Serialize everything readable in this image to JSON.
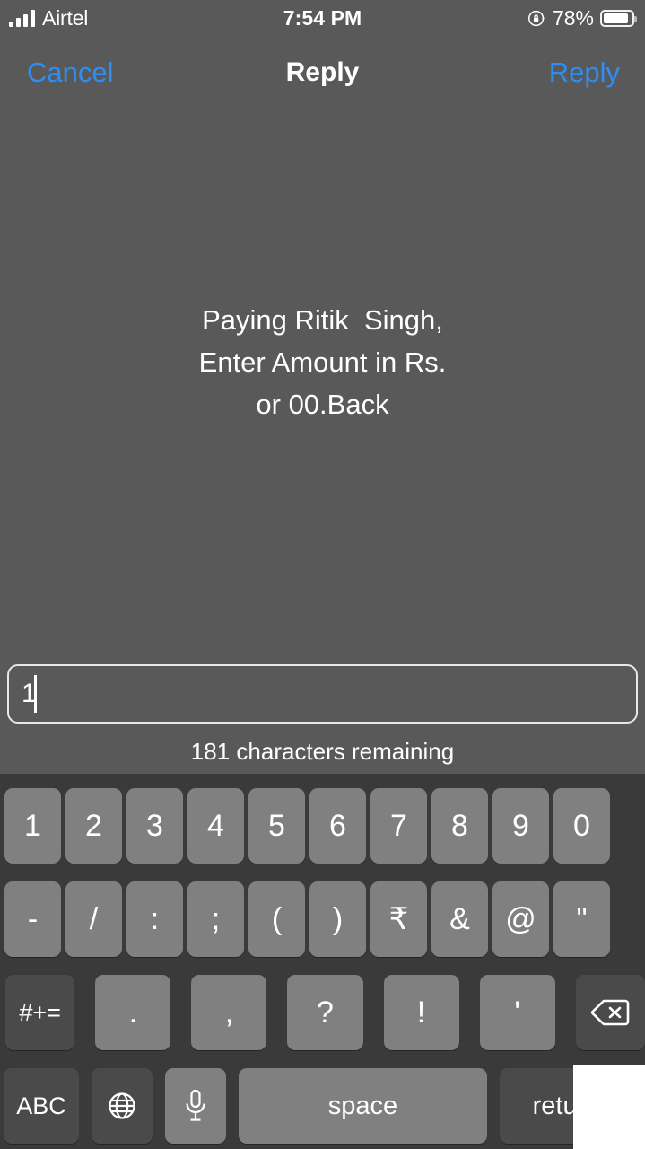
{
  "status_bar": {
    "carrier": "Airtel",
    "signal_icon": "signal-bars-icon",
    "time": "7:54 PM",
    "rotation_lock_icon": "rotation-lock-icon",
    "battery_percent": "78%",
    "battery_icon": "battery-icon"
  },
  "nav_bar": {
    "cancel_label": "Cancel",
    "title": "Reply",
    "action_label": "Reply",
    "accent_color": "#2f8ef0"
  },
  "main": {
    "message": "Paying Ritik  Singh,\nEnter Amount in Rs.\nor 00.Back"
  },
  "input": {
    "value": "1",
    "placeholder": "",
    "char_count": "181 characters remaining"
  },
  "keyboard": {
    "row1": [
      {
        "label": "1",
        "name": "key-1",
        "style": "light"
      },
      {
        "label": "2",
        "name": "key-2",
        "style": "light"
      },
      {
        "label": "3",
        "name": "key-3",
        "style": "light"
      },
      {
        "label": "4",
        "name": "key-4",
        "style": "light"
      },
      {
        "label": "5",
        "name": "key-5",
        "style": "light"
      },
      {
        "label": "6",
        "name": "key-6",
        "style": "light"
      },
      {
        "label": "7",
        "name": "key-7",
        "style": "light"
      },
      {
        "label": "8",
        "name": "key-8",
        "style": "light"
      },
      {
        "label": "9",
        "name": "key-9",
        "style": "light"
      },
      {
        "label": "0",
        "name": "key-0",
        "style": "light"
      }
    ],
    "row2": [
      {
        "label": "-",
        "name": "key-hyphen",
        "style": "light"
      },
      {
        "label": "/",
        "name": "key-slash",
        "style": "light"
      },
      {
        "label": ":",
        "name": "key-colon",
        "style": "light"
      },
      {
        "label": ";",
        "name": "key-semicolon",
        "style": "light"
      },
      {
        "label": "(",
        "name": "key-left-paren",
        "style": "light"
      },
      {
        "label": ")",
        "name": "key-right-paren",
        "style": "light"
      },
      {
        "label": "₹",
        "name": "key-rupee",
        "style": "light"
      },
      {
        "label": "&",
        "name": "key-ampersand",
        "style": "light"
      },
      {
        "label": "@",
        "name": "key-at",
        "style": "light"
      },
      {
        "label": "\"",
        "name": "key-quote",
        "style": "light"
      }
    ],
    "row3": {
      "symbols_label": "#+=",
      "keys": [
        {
          "label": ".",
          "name": "key-period"
        },
        {
          "label": ",",
          "name": "key-comma"
        },
        {
          "label": "?",
          "name": "key-question"
        },
        {
          "label": "!",
          "name": "key-exclamation"
        },
        {
          "label": "'",
          "name": "key-apostrophe"
        }
      ],
      "delete_icon": "backspace-icon"
    },
    "row4": {
      "abc_label": "ABC",
      "globe_icon": "globe-icon",
      "mic_icon": "microphone-icon",
      "space_label": "space",
      "return_label": "return"
    },
    "key_color": "#808080",
    "modifier_color": "#4a4a4a",
    "background_color": "#3a3a3a"
  }
}
